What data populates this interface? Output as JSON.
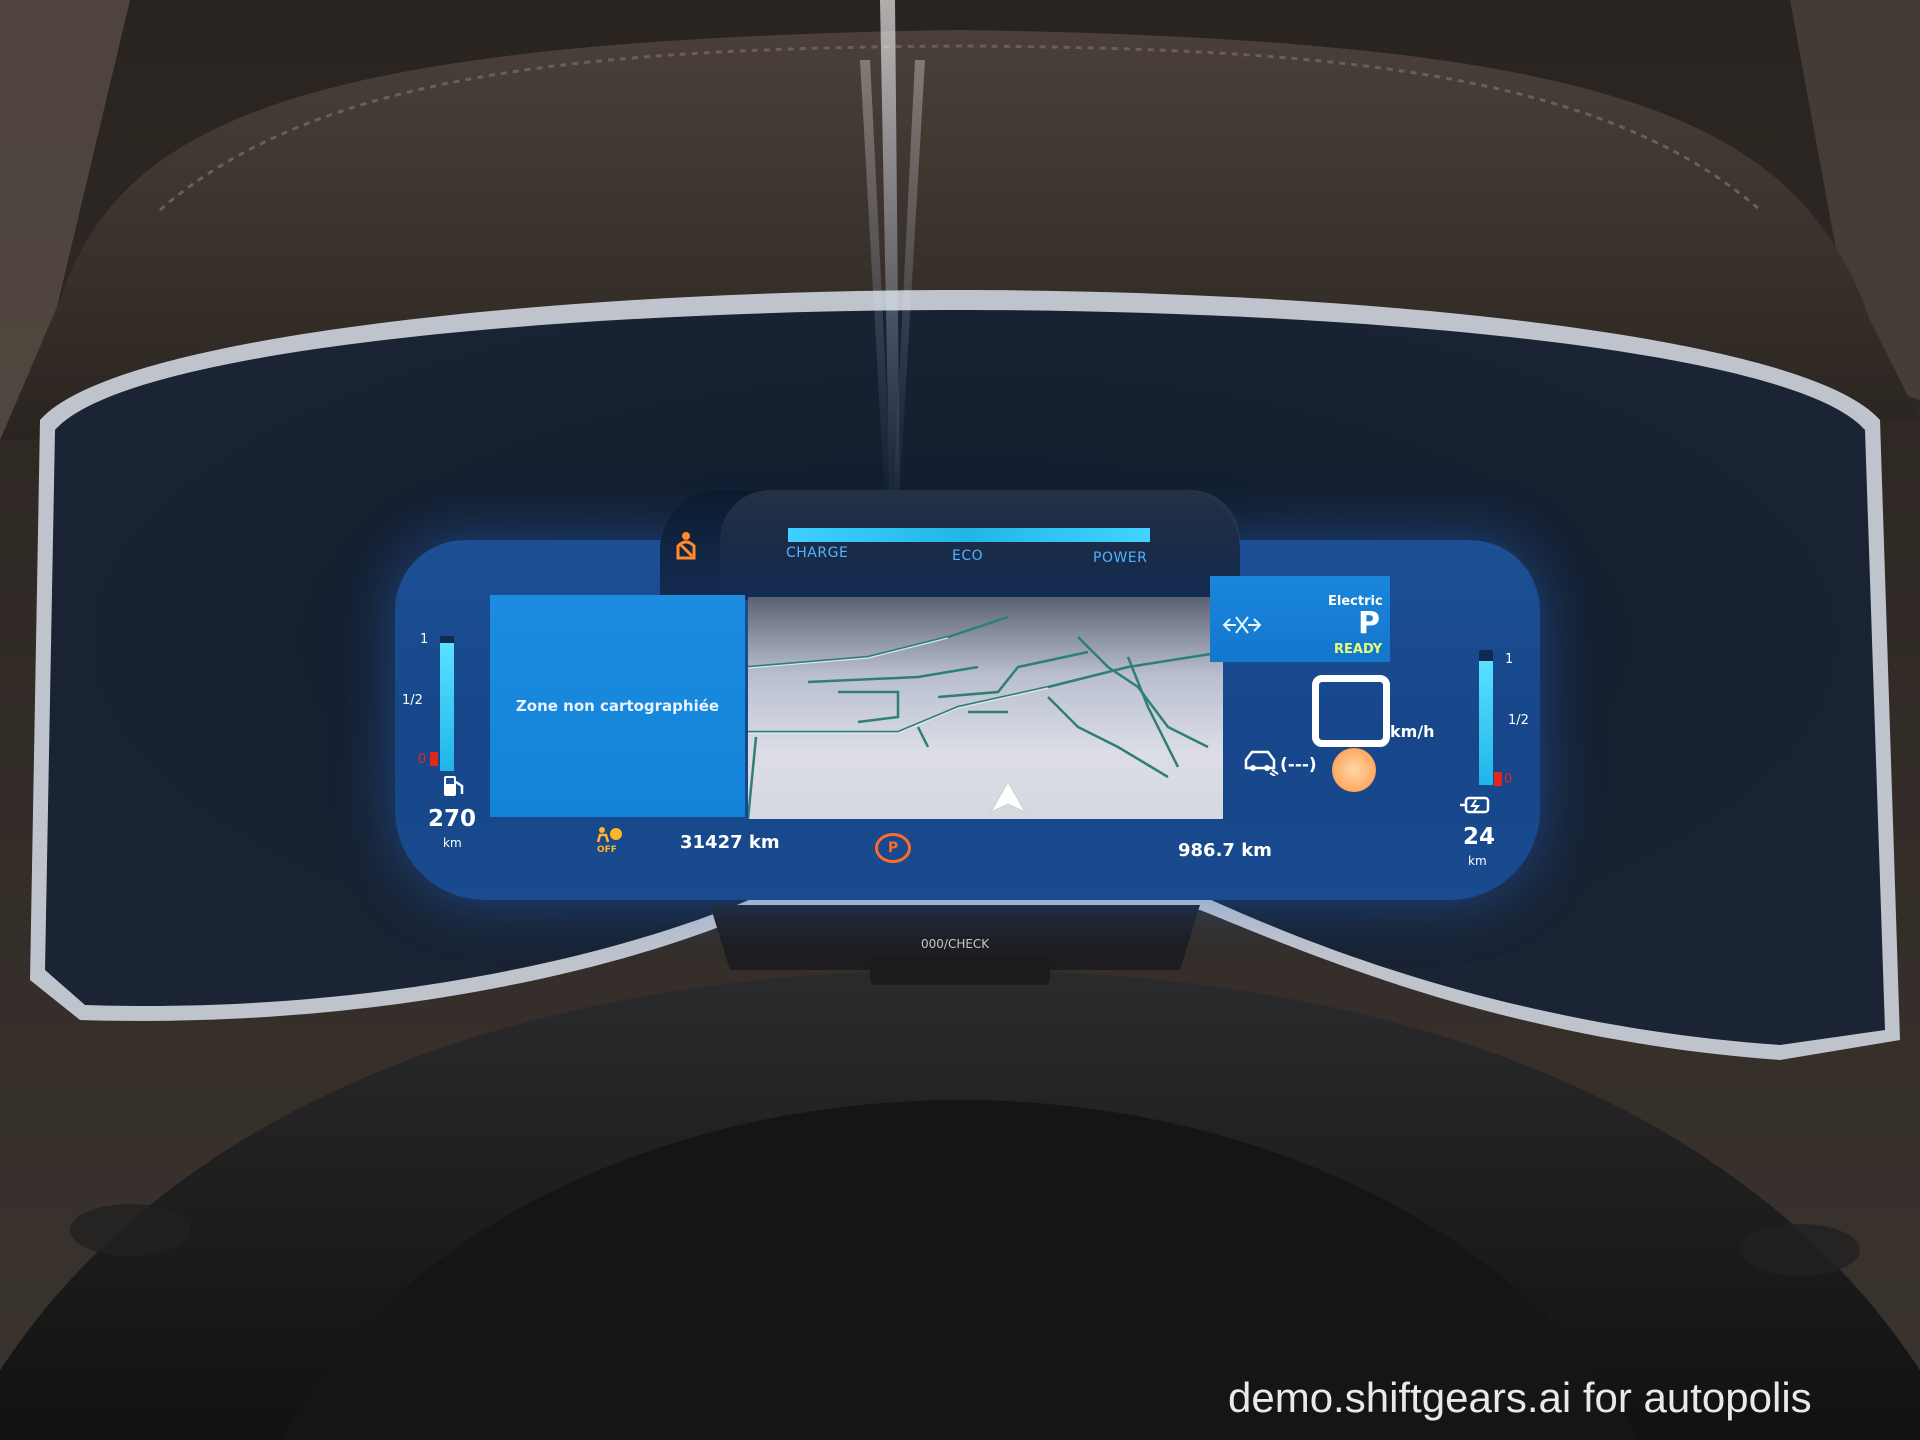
{
  "power_meter": {
    "labels": [
      "CHARGE",
      "ECO",
      "POWER"
    ]
  },
  "navigation": {
    "unmapped_zone_text": "Zone non cartographiée"
  },
  "drive": {
    "mode": "Electric",
    "gear": "P",
    "status": "READY",
    "speed_unit": "km/h",
    "cruise_setting": "(---)"
  },
  "fuel_gauge": {
    "ticks": [
      "1",
      "1/2",
      "0"
    ],
    "range": "270",
    "range_unit": "km",
    "level": 0.95
  },
  "battery_gauge": {
    "ticks": [
      "1",
      "1/2",
      "0"
    ],
    "range": "24",
    "range_unit": "km",
    "level": 0.92
  },
  "info_bar": {
    "airbag_status": "OFF",
    "odometer": "31427 km",
    "trip": "986.7 km",
    "park_brake_symbol": "P"
  },
  "steering_wheel": {
    "check_button": "000/CHECK"
  },
  "watermark": "demo.shiftgears.ai for autopolis",
  "colors": {
    "screen_blue": "#1c4f95",
    "card_blue": "#1a86dc",
    "accent_cyan": "#3fd0ff",
    "warning_orange": "#ff6a2a",
    "warning_red": "#e0271e"
  }
}
